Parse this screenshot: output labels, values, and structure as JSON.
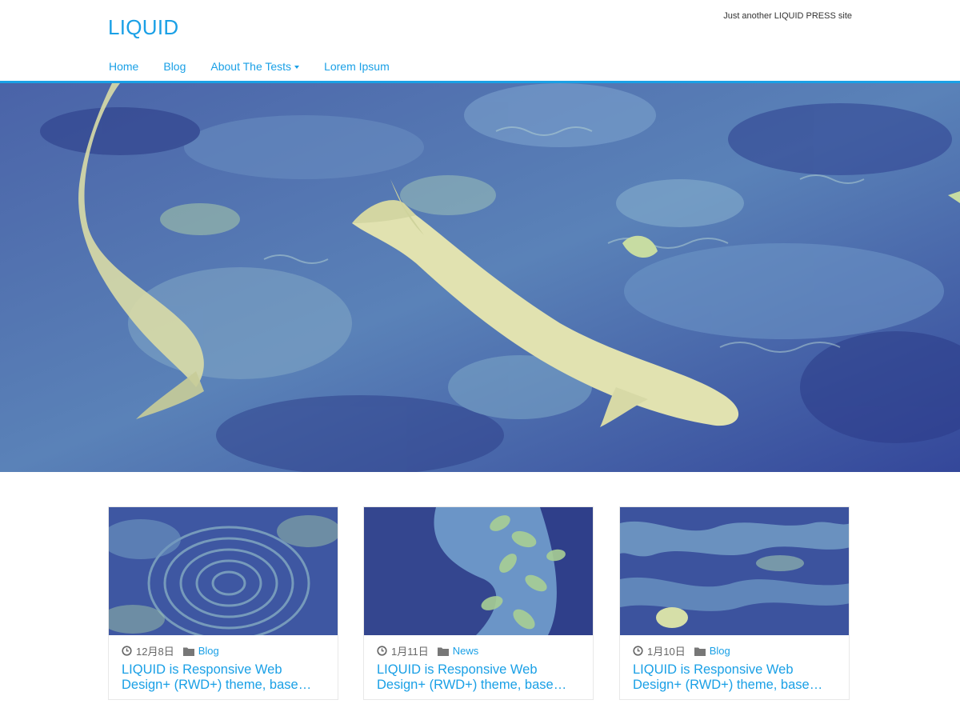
{
  "site": {
    "title": "LIQUID",
    "tagline": "Just another LIQUID PRESS site"
  },
  "nav": {
    "items": [
      {
        "label": "Home"
      },
      {
        "label": "Blog"
      },
      {
        "label": "About The Tests",
        "has_dropdown": true
      },
      {
        "label": "Lorem Ipsum"
      }
    ]
  },
  "colors": {
    "accent": "#1aa0e6",
    "hero_tint": "#3b4f9a"
  },
  "hero": {
    "image": "koi-fish-pond-photo"
  },
  "posts": [
    {
      "date": "12月8日",
      "category": "Blog",
      "title_line1": "LIQUID is Responsive Web",
      "title_line2": "Design+ (RWD+) theme, base…",
      "thumb": "water-ripple-photo"
    },
    {
      "date": "1月11日",
      "category": "News",
      "title_line1": "LIQUID is Responsive Web",
      "title_line2": "Design+ (RWD+) theme, base…",
      "thumb": "leaves-in-water-photo"
    },
    {
      "date": "1月10日",
      "category": "Blog",
      "title_line1": "LIQUID is Responsive Web",
      "title_line2": "Design+ (RWD+) theme, base…",
      "thumb": "water-reflection-photo"
    }
  ],
  "icons": {
    "date": "clock-icon",
    "category": "folder-icon"
  }
}
